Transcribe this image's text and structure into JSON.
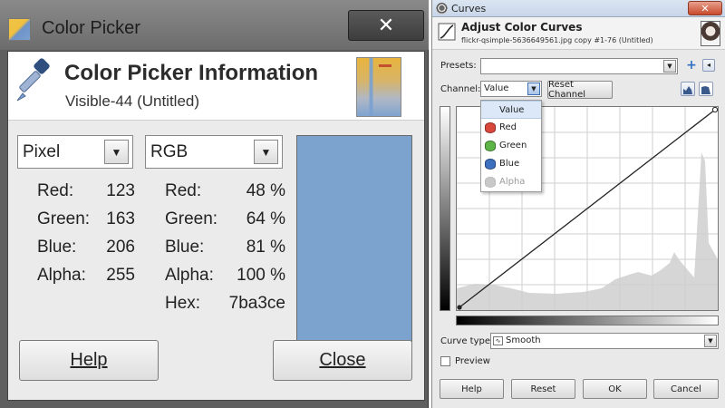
{
  "color_picker": {
    "window_title": "Color Picker",
    "close_glyph": "✕",
    "header": {
      "title": "Color Picker Information",
      "subtitle": "Visible-44 (Untitled)"
    },
    "pixel_panel": {
      "mode": "Pixel",
      "rows": [
        {
          "label": "Red:",
          "value": "123"
        },
        {
          "label": "Green:",
          "value": "163"
        },
        {
          "label": "Blue:",
          "value": "206"
        },
        {
          "label": "Alpha:",
          "value": "255"
        }
      ]
    },
    "rgb_panel": {
      "mode": "RGB",
      "rows": [
        {
          "label": "Red:",
          "value": "48 %"
        },
        {
          "label": "Green:",
          "value": "64 %"
        },
        {
          "label": "Blue:",
          "value": "81 %"
        },
        {
          "label": "Alpha:",
          "value": "100 %"
        },
        {
          "label": "Hex:",
          "value": "7ba3ce"
        }
      ]
    },
    "swatch_color": "#7ba3ce",
    "buttons": {
      "help": "Help",
      "close": "Close"
    }
  },
  "curves": {
    "window_title": "Curves",
    "close_glyph": "✕",
    "header": {
      "title": "Adjust Color Curves",
      "subtitle": "flickr-qsimple-5636649561.jpg copy #1-76 (Untitled)"
    },
    "presets_label": "Presets:",
    "presets_value": "",
    "channel_label": "Channel:",
    "channel_value": "Value",
    "reset_channel": "Reset Channel",
    "channel_options": [
      {
        "label": "Value",
        "icon": "none",
        "selected": true,
        "disabled": false
      },
      {
        "label": "Red",
        "icon": "#d9473b",
        "selected": false,
        "disabled": false
      },
      {
        "label": "Green",
        "icon": "#5db447",
        "selected": false,
        "disabled": false
      },
      {
        "label": "Blue",
        "icon": "#3d6fbf",
        "selected": false,
        "disabled": false
      },
      {
        "label": "Alpha",
        "icon": "#c8c8c8",
        "selected": false,
        "disabled": true
      }
    ],
    "curve_type_label": "Curve type:",
    "curve_type_value": "Smooth",
    "preview_label": "Preview",
    "preview_checked": false,
    "buttons": {
      "help": "Help",
      "reset": "Reset",
      "ok": "OK",
      "cancel": "Cancel"
    }
  }
}
